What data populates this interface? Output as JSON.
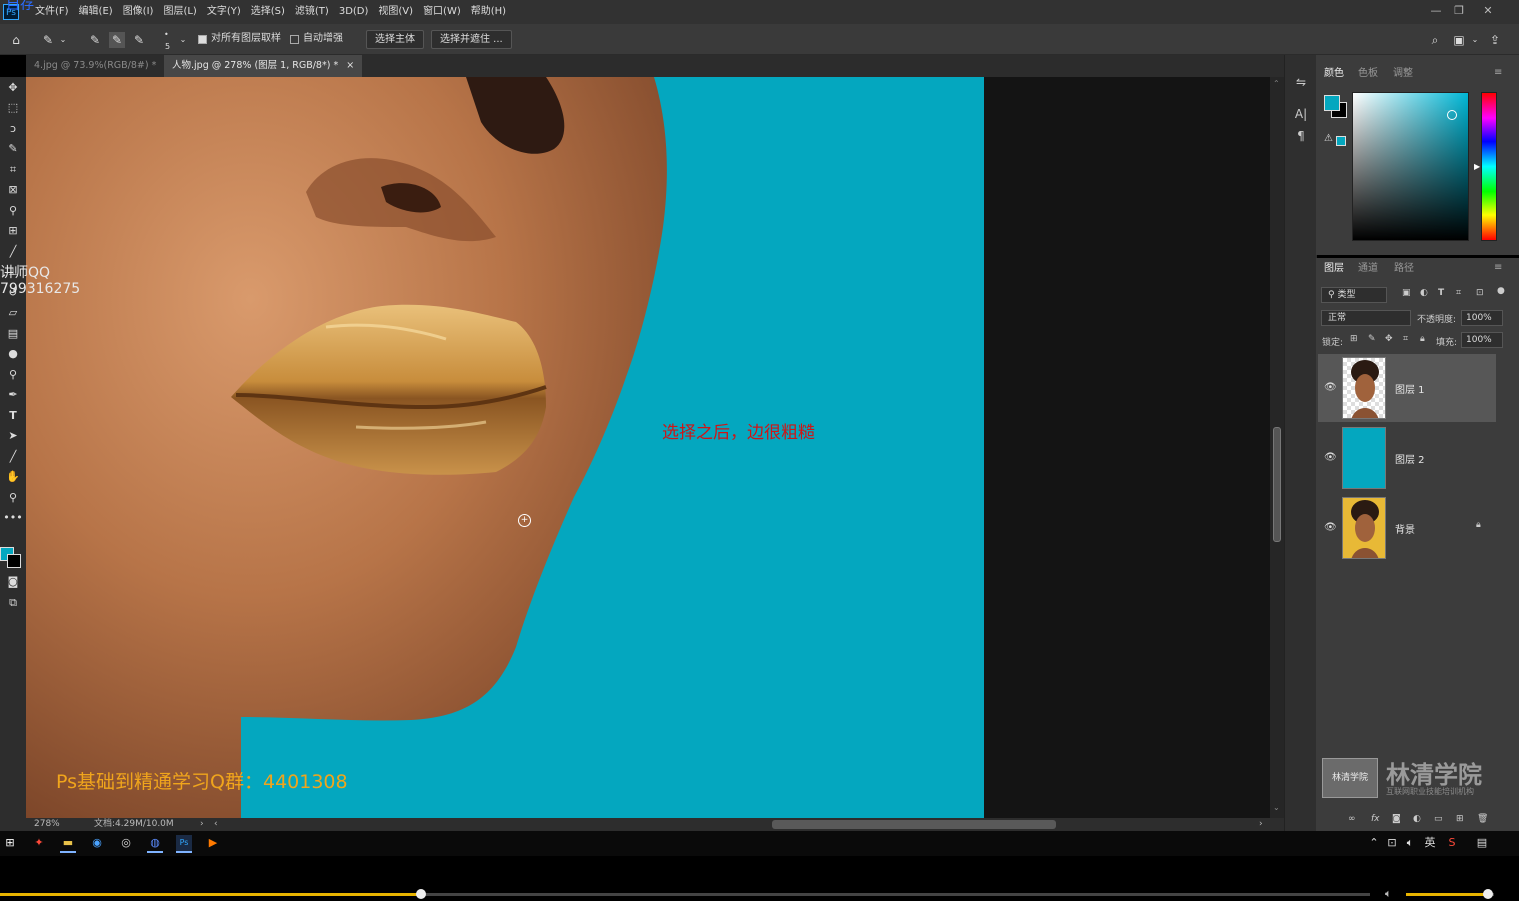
{
  "app": {
    "logo": "Ps",
    "overlay_text": "自存",
    "menus": [
      "文件(F)",
      "编辑(E)",
      "图像(I)",
      "图层(L)",
      "文字(Y)",
      "选择(S)",
      "滤镜(T)",
      "3D(D)",
      "视图(V)",
      "窗口(W)",
      "帮助(H)"
    ],
    "window_controls": [
      "—",
      "❐",
      "✕"
    ]
  },
  "options_bar": {
    "brush_size": "5",
    "sample_all_layers_label": "对所有图层取样",
    "sample_all_layers_checked": true,
    "auto_enhance_label": "自动增强",
    "auto_enhance_checked": false,
    "select_subject_label": "选择主体",
    "select_and_mask_label": "选择并遮住 ..."
  },
  "tabs": [
    {
      "label": "4.jpg @ 73.9%(RGB/8#) *",
      "close": "×",
      "active": false
    },
    {
      "label": "人物.jpg @ 278% (图层 1, RGB/8*) *",
      "close": "×",
      "active": true
    }
  ],
  "canvas": {
    "annotation": "选择之后，边很粗糙",
    "watermark_bottom": "Ps基础到精通学习Q群：4401308",
    "watermark_left_line1": "讲师QQ",
    "watermark_left_line2": "799316275",
    "canvas_bg_color": "#04a7bf"
  },
  "status": {
    "zoom": "278%",
    "doc_info": "文档:4.29M/10.0M"
  },
  "color_panel": {
    "tabs": [
      "颜色",
      "色板",
      "调整"
    ],
    "foreground": "#04a7bf",
    "background": "#000000"
  },
  "layers_panel": {
    "tabs": [
      "图层",
      "通道",
      "路径"
    ],
    "filter_label": "类型",
    "blend_mode": "正常",
    "opacity_label": "不透明度:",
    "opacity_value": "100%",
    "lock_label": "锁定:",
    "fill_label": "填充:",
    "fill_value": "100%",
    "layers": [
      {
        "name": "图层 1",
        "selected": true,
        "locked": false
      },
      {
        "name": "图层 2",
        "selected": false,
        "locked": false
      },
      {
        "name": "背景",
        "selected": false,
        "locked": true
      }
    ]
  },
  "logo_watermark": {
    "title": "林清学院",
    "badge": "林清学院",
    "subtitle": "互联网职业技能培训机构"
  },
  "taskbar": {
    "tray_ime": "英"
  },
  "player": {
    "progress": 0.307,
    "volume": 0.93
  }
}
